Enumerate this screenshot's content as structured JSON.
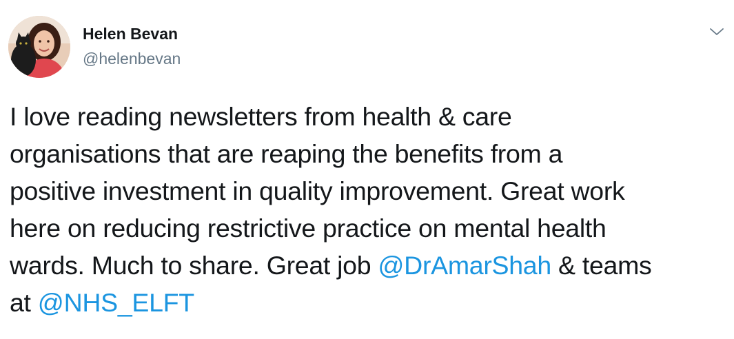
{
  "author": {
    "display_name": "Helen Bevan",
    "handle": "@helenbevan"
  },
  "icons": {
    "menu": "chevron-down-icon",
    "avatar": "profile-photo"
  },
  "colors": {
    "text": "#14171a",
    "secondary": "#657786",
    "link": "#1b95e0"
  },
  "tweet": {
    "line1": "I love reading newsletters from health & care",
    "line2": "organisations that are reaping the benefits from a",
    "line3": "positive investment in quality improvement. Great work",
    "line4": "here on reducing restrictive practice on mental health",
    "line5_before": "wards. Much to share. Great job ",
    "mention1": "@DrAmarShah",
    "line5_after": " & teams",
    "line6_before": "at ",
    "mention2": "@NHS_ELFT"
  }
}
